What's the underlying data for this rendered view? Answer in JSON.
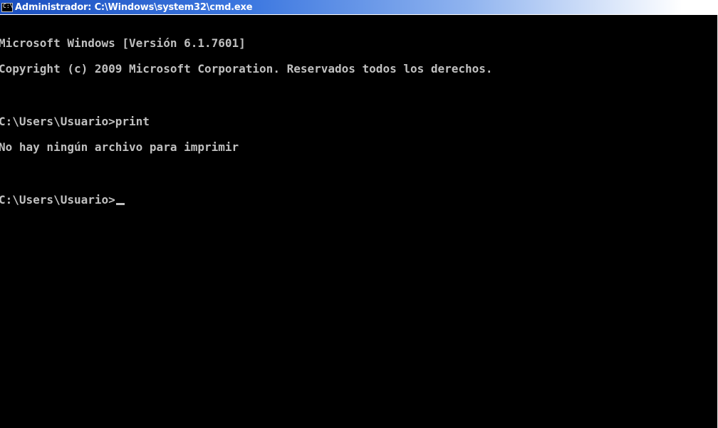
{
  "window": {
    "title": "Administrador: C:\\Windows\\system32\\cmd.exe",
    "icon": "cmd-console-icon",
    "icon_text": "C:\\",
    "title_gradient_start": "#1b4fbf",
    "console_background": "#000000",
    "console_text_color": "#c0c0c0"
  },
  "console": {
    "lines": [
      "Microsoft Windows [Versión 6.1.7601]",
      "Copyright (c) 2009 Microsoft Corporation. Reservados todos los derechos.",
      "",
      "C:\\Users\\Usuario>print",
      "No hay ningún archivo para imprimir",
      "",
      "C:\\Users\\Usuario>"
    ],
    "cursor": "_"
  }
}
